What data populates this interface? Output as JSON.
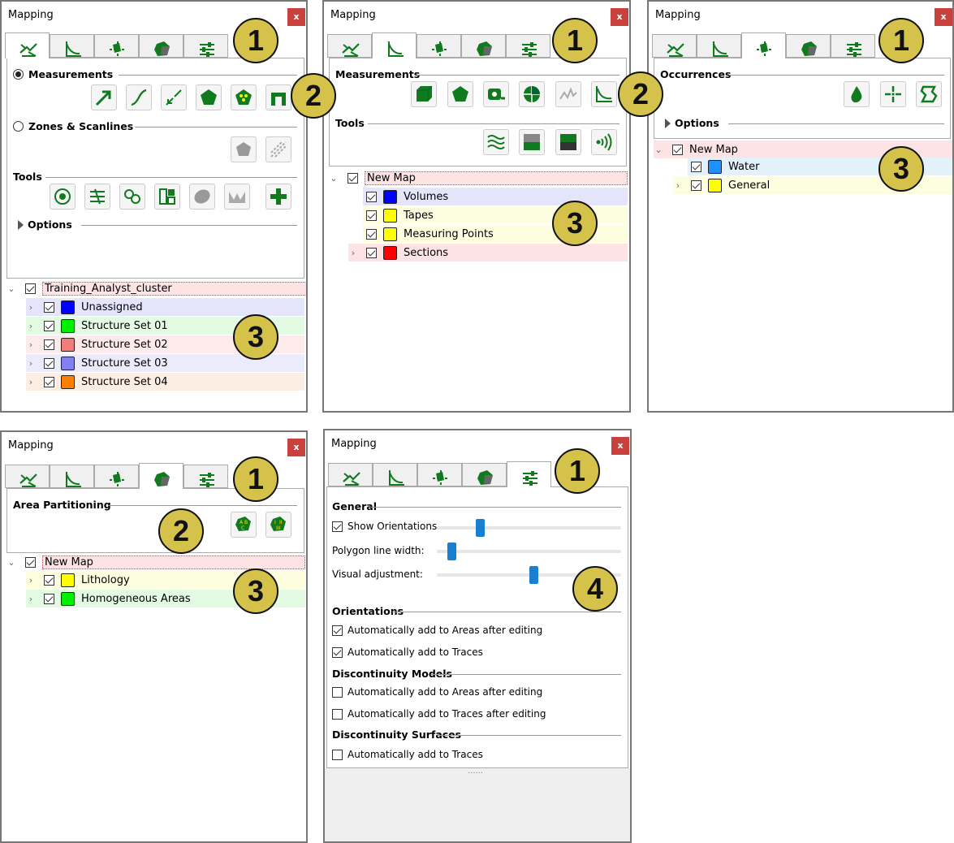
{
  "panel_title": "Mapping",
  "close_label": "x",
  "p1": {
    "section_measurements": "Measurements",
    "section_zones": "Zones & Scanlines",
    "section_tools": "Tools",
    "section_options": "Options",
    "tree_root": "Training_Analyst_cluster",
    "tree_items": [
      "Unassigned",
      "Structure Set 01",
      "Structure Set 02",
      "Structure Set 03",
      "Structure Set 04"
    ]
  },
  "p2": {
    "section_measurements": "Measurements",
    "section_tools": "Tools",
    "tree_root": "New Map",
    "tree_items": [
      "Volumes",
      "Tapes",
      "Measuring Points",
      "Sections"
    ]
  },
  "p3": {
    "section_occurrences": "Occurrences",
    "section_options": "Options",
    "tree_root": "New Map",
    "tree_items": [
      "Water",
      "General"
    ]
  },
  "p4": {
    "section_area": "Area Partitioning",
    "tree_root": "New Map",
    "tree_items": [
      "Lithology",
      "Homogeneous Areas"
    ]
  },
  "p5": {
    "section_general": "General",
    "show_orientations": "Show Orientations",
    "show_orientations_level": 0.22,
    "polygon_line_width": "Polygon line width:",
    "polygon_line_width_level": 0.06,
    "visual_adjustment": "Visual adjustment:",
    "visual_adjustment_level": 0.53,
    "section_orientations": "Orientations",
    "orient_opt1": "Automatically add to Areas after editing",
    "orient_opt2": "Automatically add to Traces",
    "section_disc_models": "Discontinuity Models",
    "models_opt1": "Automatically add to Areas after editing",
    "models_opt2": "Automatically add to Traces after editing",
    "section_disc_surfaces": "Discontinuity Surfaces",
    "surfaces_opt1": "Automatically add to Traces",
    "grip": "......"
  },
  "badges": {
    "one": "1",
    "two": "2",
    "three": "3",
    "four": "4"
  },
  "colors": {
    "blue": "#0000ff",
    "green": "#00ee00",
    "salmon": "#f27c7c",
    "lavender": "#8080f0",
    "orange": "#ff7f00",
    "yellow": "#ffff00",
    "red": "#ff0000",
    "water": "#1e90ff",
    "icon_green": "#117a1f",
    "close": "#c9413d",
    "badge": "#d5c24b"
  }
}
